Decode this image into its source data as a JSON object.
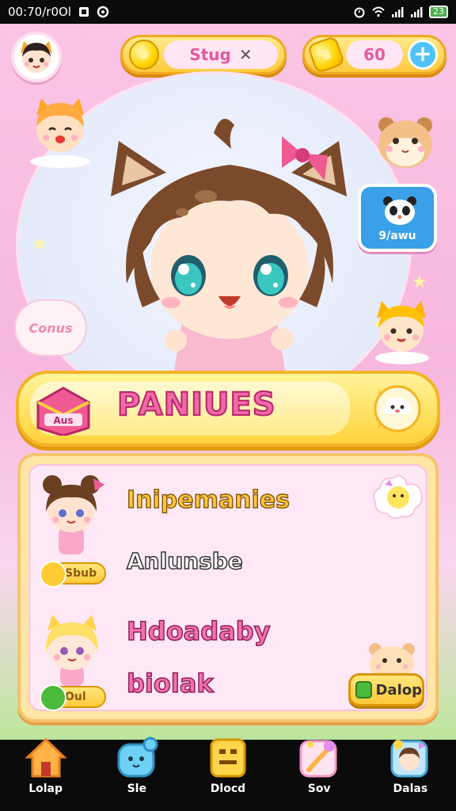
{
  "status_bar": {
    "time_text": "00:70/r0Ol",
    "battery_text": "23"
  },
  "hud": {
    "left_pill_text": "Stug",
    "left_pill_extra": "✕",
    "right_pill_value": "60",
    "plus_symbol": "+"
  },
  "hero": {
    "badge_text": "9/awu",
    "speech_text": "Conus"
  },
  "banner": {
    "icon_text": "Aus",
    "title": "PANIUES"
  },
  "panel": {
    "rows": [
      {
        "title": "Inipemanies",
        "pill_text": "Sbub"
      },
      {
        "title": "Anlunsbe"
      },
      {
        "title": "Hdoadaby"
      },
      {
        "title": "biolak",
        "pill_text": "Oul"
      }
    ],
    "action_button": "Dalop"
  },
  "nav": {
    "items": [
      {
        "label": "Lolap",
        "icon": "home-icon",
        "color": "#ffb347"
      },
      {
        "label": "Sle",
        "icon": "slime-icon",
        "color": "#6fd0f5"
      },
      {
        "label": "Dlocd",
        "icon": "block-icon",
        "color": "#ffd64a"
      },
      {
        "label": "Sov",
        "icon": "wand-icon",
        "color": "#f59ac8"
      },
      {
        "label": "Dalas",
        "icon": "character-icon",
        "color": "#8fd0f5"
      }
    ]
  },
  "colors": {
    "accent_pink": "#f06aa8",
    "accent_yellow": "#ffd23c",
    "nav_background": "#0b0b0b"
  }
}
